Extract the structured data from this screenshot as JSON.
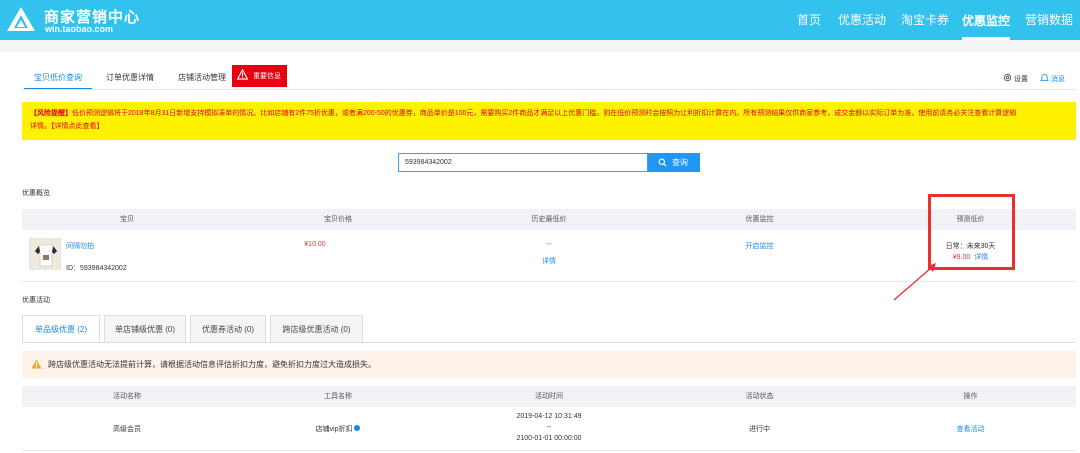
{
  "brand": {
    "title": "商家营销中心",
    "url": "win.taobao.com"
  },
  "nav": [
    "首页",
    "优惠活动",
    "淘宝卡券",
    "优惠监控",
    "营销数据中"
  ],
  "tabs": [
    "宝贝低价查询",
    "订单优惠详情",
    "店铺活动管理"
  ],
  "alert_tab": "重要信息",
  "top_right": {
    "settings": "设置",
    "messages": "消息"
  },
  "notice": {
    "label": "【风险提醒】",
    "text": "低价预测逻辑将于2018年8月31日新增支持模拟凑单的情况。比如店铺有2件75折优惠，或者满200-50的优惠券，商品单价是100元，需要购买2件商品才满足以上优惠门槛，则在低价预测时会按照为让利折扣计算在内。所有预测结果仅供商家参考，成交金额以实际订单为准，使用前请务必关注查看计算逻辑",
    "text2": "详情。",
    "link": "【详情点此查看】"
  },
  "search": {
    "value": "593984342002",
    "button": "查询"
  },
  "overview": {
    "title": "优惠概览",
    "headers": [
      "宝贝",
      "宝贝价格",
      "历史最低价",
      "优惠监控",
      "预测低价"
    ],
    "item_name": "间隔勿拍",
    "item_id": "ID：593984342002",
    "price": "¥10.00",
    "history_low": "--",
    "history_detail": "详情",
    "monitor": "开启监控",
    "forecast_label": "日常：未来30天",
    "forecast_price": "¥9.00",
    "forecast_detail": "详情"
  },
  "campaign": {
    "title": "优惠活动",
    "tabs": [
      "单品级优惠 (2)",
      "单店铺级优惠 (0)",
      "优惠券活动 (0)",
      "跨店级优惠活动 (0)"
    ],
    "warning": "跨店级优惠活动无法提前计算，请根据活动信息评估折扣力度，避免折扣力度过大造成损失。",
    "headers": [
      "活动名称",
      "工具名称",
      "活动时间",
      "活动状态",
      "操作"
    ],
    "rows": [
      {
        "name": "高级会员",
        "tool": "店铺vip折扣",
        "time_start": "2019-04-12 10:31:49",
        "sep": "--",
        "time_end": "2100-01-01 00:00:00",
        "status": "进行中",
        "action": "查看活动"
      }
    ]
  },
  "colors": {
    "topbar": "#33c1ee",
    "accent": "#1e88e5",
    "alert": "#e60012",
    "notice_bg": "#fff200",
    "highlight": "#e8312f"
  }
}
